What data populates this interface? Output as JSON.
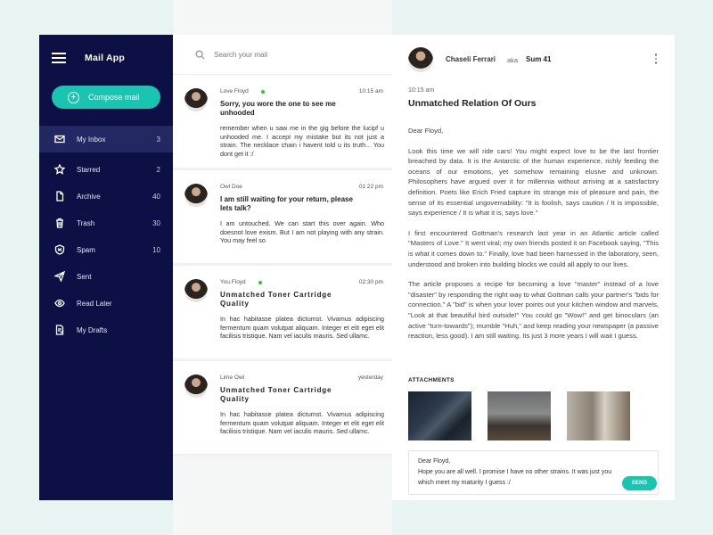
{
  "app": {
    "title": "Mail App"
  },
  "compose": {
    "label": "Compose mail"
  },
  "sidebar": {
    "items": [
      {
        "label": "My Inbox",
        "count": "3",
        "icon": "inbox-icon"
      },
      {
        "label": "Starred",
        "count": "2",
        "icon": "star-icon"
      },
      {
        "label": "Archive",
        "count": "40",
        "icon": "file-icon"
      },
      {
        "label": "Trash",
        "count": "30",
        "icon": "trash-icon"
      },
      {
        "label": "Spam",
        "count": "10",
        "icon": "spam-icon"
      },
      {
        "label": "Sent",
        "count": "",
        "icon": "send-icon"
      },
      {
        "label": "Read Later",
        "count": "",
        "icon": "eye-icon"
      },
      {
        "label": "My Drafts",
        "count": "",
        "icon": "drafts-icon"
      }
    ]
  },
  "search": {
    "placeholder": "Search your mail"
  },
  "mails": [
    {
      "from": "Love Floyd",
      "time": "10:15 am",
      "subject": "Sorry, you wore the one to see me unhooded",
      "snippet": "remember when u saw me in the gig before the lucipf u unhooded me. I accept my mistake but its not just a strain. The necklace chain i havent told u its truth... You dont get it :/"
    },
    {
      "from": "Owl Doe",
      "time": "01:22 pm",
      "subject": "I am still waiting for your return, please lets talk?",
      "snippet": "I am untouched. We can start this over again. Who doesnot love exism. But I am not playing with any strain. You may feel so"
    },
    {
      "from": "You Floyd",
      "time": "02:30 pm",
      "subject": "Unmatched Toner Cartridge Quality",
      "snippet": "In hac habitasse platea dictumst. Vivamus adipiscing fermentum quam volutpat aliquam. Integer et elit eget elit facilisis tristique. Nam vel iaculis mauris. Sed ullamc."
    },
    {
      "from": "Lime Owl",
      "time": "yesterday",
      "subject": "Unmatched Toner Cartridge Quality",
      "snippet": "In hac habitasse platea dictumst. Vivamus adipiscing fermentum quam volutpat aliquam. Integer et elit eget elit facilisis tristique. Nam vel iaculis mauris. Sed ullamc."
    }
  ],
  "reader": {
    "name": "Chaseli Ferrari",
    "aka": "aka",
    "alias": "Sum 41",
    "time": "10:15 am",
    "subject": "Unmatched Relation Of Ours",
    "greeting": "Dear Floyd,",
    "paragraphs": [
      "Look this time we will ride cars! You might expect love to be the last frontier breached by data. It is the Antarctic of the human experience, richly feeding the oceans of our emotions, yet somehow remaining elusive and unknown. Philosophers have argued over it for millennia without arriving at a satisfactory definition. Poets like Erich Fried capture its strange mix of pleasure and pain, the sense of its essential ungovernability: \"It is foolish, says caution / It is impossible, says experience / It is what it is, says love.\"",
      "I first encountered Gottman's research last year in an Atlantic article called \"Masters of Love.\" It went viral; my own friends posted it on Facebook saying, \"This is what it comes down to.\" Finally, love had been harnessed in the laboratory, seen, understood and broken into building blocks we could all apply to our lives.",
      "The article proposes a recipe for becoming a love \"master\" instead of a love \"disaster\" by responding the right way to what Gottman calls your partner's \"bids for connection.\" A \"bid\" is when your lover points out your kitchen window and marvels, \"Look at that beautiful bird outside!\" You could go \"Wow!\" and get binoculars (an active \"turn-towards\"); mumble \"Huh,\" and keep reading your newspaper (a passive reaction, less good). I am still waiting. Its just 3 more years I will wait I guess."
    ],
    "attachments_title": "ATTACHMENTS",
    "reply_text": "Dear Floyd,\nHope you are all well. I promise I have no other strains. It was just you which meet my maturity I guess :/",
    "send_label": "SEND"
  },
  "colors": {
    "sidebar": "#0c1045",
    "accent": "#19c4b0",
    "online": "#27c93f"
  }
}
